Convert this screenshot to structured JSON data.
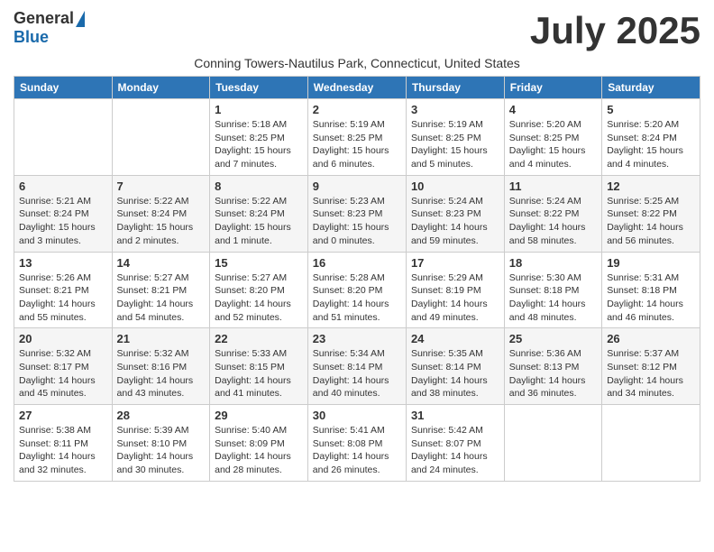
{
  "header": {
    "logo_general": "General",
    "logo_blue": "Blue",
    "month_title": "July 2025",
    "subtitle": "Conning Towers-Nautilus Park, Connecticut, United States"
  },
  "days_of_week": [
    "Sunday",
    "Monday",
    "Tuesday",
    "Wednesday",
    "Thursday",
    "Friday",
    "Saturday"
  ],
  "weeks": [
    [
      {
        "day": "",
        "info": ""
      },
      {
        "day": "",
        "info": ""
      },
      {
        "day": "1",
        "info": "Sunrise: 5:18 AM\nSunset: 8:25 PM\nDaylight: 15 hours and 7 minutes."
      },
      {
        "day": "2",
        "info": "Sunrise: 5:19 AM\nSunset: 8:25 PM\nDaylight: 15 hours and 6 minutes."
      },
      {
        "day": "3",
        "info": "Sunrise: 5:19 AM\nSunset: 8:25 PM\nDaylight: 15 hours and 5 minutes."
      },
      {
        "day": "4",
        "info": "Sunrise: 5:20 AM\nSunset: 8:25 PM\nDaylight: 15 hours and 4 minutes."
      },
      {
        "day": "5",
        "info": "Sunrise: 5:20 AM\nSunset: 8:24 PM\nDaylight: 15 hours and 4 minutes."
      }
    ],
    [
      {
        "day": "6",
        "info": "Sunrise: 5:21 AM\nSunset: 8:24 PM\nDaylight: 15 hours and 3 minutes."
      },
      {
        "day": "7",
        "info": "Sunrise: 5:22 AM\nSunset: 8:24 PM\nDaylight: 15 hours and 2 minutes."
      },
      {
        "day": "8",
        "info": "Sunrise: 5:22 AM\nSunset: 8:24 PM\nDaylight: 15 hours and 1 minute."
      },
      {
        "day": "9",
        "info": "Sunrise: 5:23 AM\nSunset: 8:23 PM\nDaylight: 15 hours and 0 minutes."
      },
      {
        "day": "10",
        "info": "Sunrise: 5:24 AM\nSunset: 8:23 PM\nDaylight: 14 hours and 59 minutes."
      },
      {
        "day": "11",
        "info": "Sunrise: 5:24 AM\nSunset: 8:22 PM\nDaylight: 14 hours and 58 minutes."
      },
      {
        "day": "12",
        "info": "Sunrise: 5:25 AM\nSunset: 8:22 PM\nDaylight: 14 hours and 56 minutes."
      }
    ],
    [
      {
        "day": "13",
        "info": "Sunrise: 5:26 AM\nSunset: 8:21 PM\nDaylight: 14 hours and 55 minutes."
      },
      {
        "day": "14",
        "info": "Sunrise: 5:27 AM\nSunset: 8:21 PM\nDaylight: 14 hours and 54 minutes."
      },
      {
        "day": "15",
        "info": "Sunrise: 5:27 AM\nSunset: 8:20 PM\nDaylight: 14 hours and 52 minutes."
      },
      {
        "day": "16",
        "info": "Sunrise: 5:28 AM\nSunset: 8:20 PM\nDaylight: 14 hours and 51 minutes."
      },
      {
        "day": "17",
        "info": "Sunrise: 5:29 AM\nSunset: 8:19 PM\nDaylight: 14 hours and 49 minutes."
      },
      {
        "day": "18",
        "info": "Sunrise: 5:30 AM\nSunset: 8:18 PM\nDaylight: 14 hours and 48 minutes."
      },
      {
        "day": "19",
        "info": "Sunrise: 5:31 AM\nSunset: 8:18 PM\nDaylight: 14 hours and 46 minutes."
      }
    ],
    [
      {
        "day": "20",
        "info": "Sunrise: 5:32 AM\nSunset: 8:17 PM\nDaylight: 14 hours and 45 minutes."
      },
      {
        "day": "21",
        "info": "Sunrise: 5:32 AM\nSunset: 8:16 PM\nDaylight: 14 hours and 43 minutes."
      },
      {
        "day": "22",
        "info": "Sunrise: 5:33 AM\nSunset: 8:15 PM\nDaylight: 14 hours and 41 minutes."
      },
      {
        "day": "23",
        "info": "Sunrise: 5:34 AM\nSunset: 8:14 PM\nDaylight: 14 hours and 40 minutes."
      },
      {
        "day": "24",
        "info": "Sunrise: 5:35 AM\nSunset: 8:14 PM\nDaylight: 14 hours and 38 minutes."
      },
      {
        "day": "25",
        "info": "Sunrise: 5:36 AM\nSunset: 8:13 PM\nDaylight: 14 hours and 36 minutes."
      },
      {
        "day": "26",
        "info": "Sunrise: 5:37 AM\nSunset: 8:12 PM\nDaylight: 14 hours and 34 minutes."
      }
    ],
    [
      {
        "day": "27",
        "info": "Sunrise: 5:38 AM\nSunset: 8:11 PM\nDaylight: 14 hours and 32 minutes."
      },
      {
        "day": "28",
        "info": "Sunrise: 5:39 AM\nSunset: 8:10 PM\nDaylight: 14 hours and 30 minutes."
      },
      {
        "day": "29",
        "info": "Sunrise: 5:40 AM\nSunset: 8:09 PM\nDaylight: 14 hours and 28 minutes."
      },
      {
        "day": "30",
        "info": "Sunrise: 5:41 AM\nSunset: 8:08 PM\nDaylight: 14 hours and 26 minutes."
      },
      {
        "day": "31",
        "info": "Sunrise: 5:42 AM\nSunset: 8:07 PM\nDaylight: 14 hours and 24 minutes."
      },
      {
        "day": "",
        "info": ""
      },
      {
        "day": "",
        "info": ""
      }
    ]
  ]
}
